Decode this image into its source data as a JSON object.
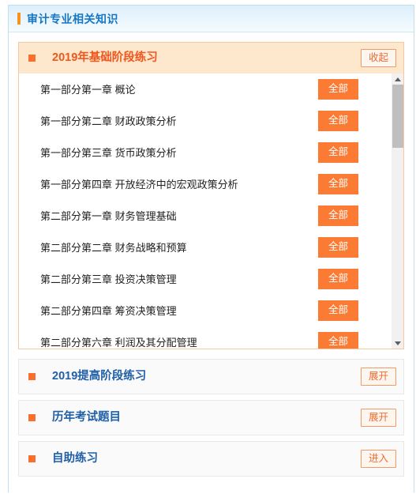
{
  "header": {
    "title": "审计专业相关知识",
    "accent_bar_color": "#f7941d",
    "title_color": "#1777c4"
  },
  "expanded_group": {
    "title": "2019年基础阶段练习",
    "toggle_label": "收起",
    "bullet_icon": "square-bullet-icon",
    "head_bg": "#fde8cd",
    "title_color": "#f0561d",
    "rows": [
      {
        "label": "第一部分第一章  概论",
        "action": "全部"
      },
      {
        "label": "第一部分第二章  财政政策分析",
        "action": "全部"
      },
      {
        "label": "第一部分第三章  货币政策分析",
        "action": "全部"
      },
      {
        "label": "第一部分第四章  开放经济中的宏观政策分析",
        "action": "全部"
      },
      {
        "label": "第二部分第一章  财务管理基础",
        "action": "全部"
      },
      {
        "label": "第二部分第二章  财务战略和预算",
        "action": "全部"
      },
      {
        "label": "第二部分第三章  投资决策管理",
        "action": "全部"
      },
      {
        "label": "第二部分第四章  筹资决策管理",
        "action": "全部"
      },
      {
        "label": "第二部分第六章  利润及其分配管理",
        "action": "全部"
      }
    ],
    "scrollbar": {
      "up_icon": "triangle-up-icon",
      "down_icon": "triangle-down-icon",
      "thumb_color": "#bfbfbf",
      "track_color": "#f1f1f1"
    }
  },
  "collapsed_groups": [
    {
      "title": "2019提高阶段练习",
      "action": "展开",
      "bullet_icon": "square-bullet-icon"
    },
    {
      "title": "历年考试题目",
      "action": "展开",
      "bullet_icon": "square-bullet-icon"
    },
    {
      "title": "自助练习",
      "action": "进入",
      "bullet_icon": "square-bullet-icon"
    }
  ],
  "colors": {
    "solid_button": "#fb7a34",
    "outline_button_border": "#f29a6a",
    "outline_button_text": "#ef6c33",
    "collapsed_title": "#1f5fa8"
  }
}
